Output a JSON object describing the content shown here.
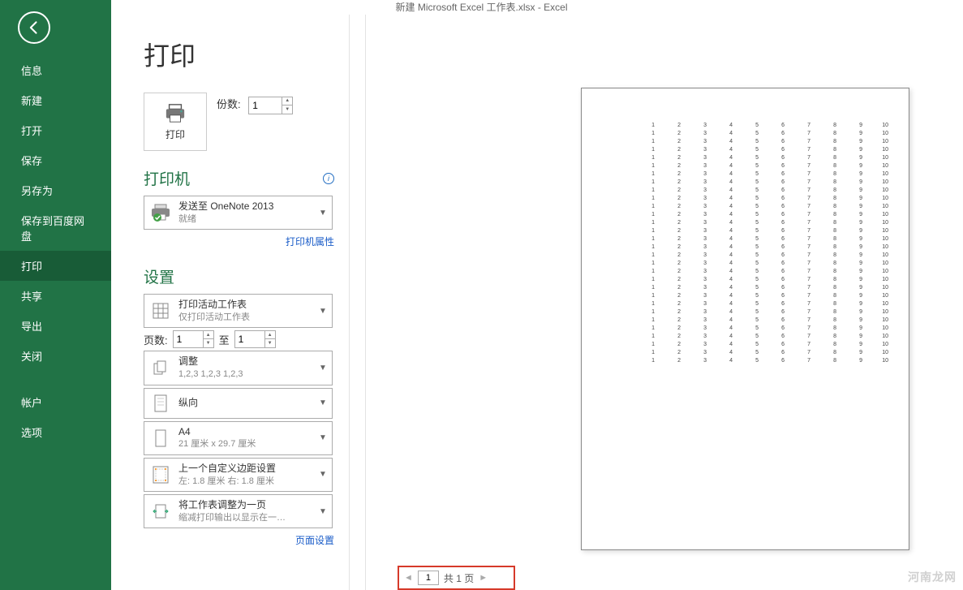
{
  "title": "新建 Microsoft Excel 工作表.xlsx - Excel",
  "sidebar": {
    "items": [
      "信息",
      "新建",
      "打开",
      "保存",
      "另存为",
      "保存到百度网盘",
      "打印",
      "共享",
      "导出",
      "关闭"
    ],
    "items2": [
      "帐户",
      "选项"
    ],
    "active_index": 6
  },
  "page": {
    "heading": "打印",
    "print_label": "打印",
    "copies_label": "份数:",
    "copies_value": "1",
    "printer_section": "打印机",
    "printer_name": "发送至 OneNote 2013",
    "printer_status": "就绪",
    "printer_props": "打印机属性",
    "settings_section": "设置",
    "print_what_title": "打印活动工作表",
    "print_what_sub": "仅打印活动工作表",
    "pages_label": "页数:",
    "pages_from": "1",
    "pages_to_label": "至",
    "pages_to": "1",
    "collate_title": "调整",
    "collate_sub": "1,2,3    1,2,3    1,2,3",
    "orient": "纵向",
    "paper_title": "A4",
    "paper_sub": "21 厘米 x 29.7 厘米",
    "margin_title": "上一个自定义边距设置",
    "margin_sub": "左:  1.8 厘米    右:  1.8 厘米",
    "scale_title": "将工作表调整为一页",
    "scale_sub": "缩减打印输出以显示在一…",
    "page_setup": "页面设置"
  },
  "pager": {
    "current": "1",
    "total_label": "共 1 页"
  },
  "preview": {
    "rows": 30,
    "cols": 10
  },
  "watermark": "河南龙网"
}
